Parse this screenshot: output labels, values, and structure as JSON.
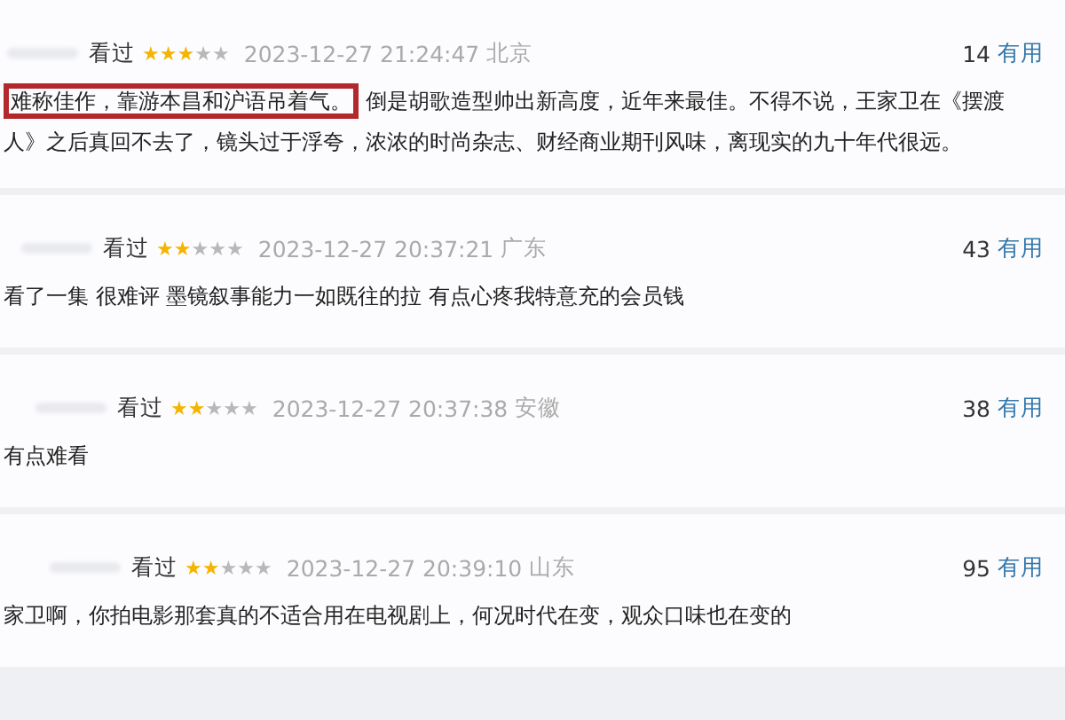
{
  "reviews": [
    {
      "status": "看过",
      "stars": 3,
      "time": "2023-12-27 21:24:47",
      "location": "北京",
      "votes": "14",
      "vote_label": "有用",
      "highlight": "难称佳作，靠游本昌和沪语吊着气。",
      "text": "倒是胡歌造型帅出新高度，近年来最佳。不得不说，王家卫在《摆渡人》之后真回不去了，镜头过于浮夸，浓浓的时尚杂志、财经商业期刊风味，离现实的九十年代很远。"
    },
    {
      "status": "看过",
      "stars": 2,
      "time": "2023-12-27 20:37:21",
      "location": "广东",
      "votes": "43",
      "vote_label": "有用",
      "text": "看了一集 很难评 墨镜叙事能力一如既往的拉 有点心疼我特意充的会员钱"
    },
    {
      "status": "看过",
      "stars": 2,
      "time": "2023-12-27 20:37:38",
      "location": "安徽",
      "votes": "38",
      "vote_label": "有用",
      "text": "有点难看"
    },
    {
      "status": "看过",
      "stars": 2,
      "time": "2023-12-27 20:39:10",
      "location": "山东",
      "votes": "95",
      "vote_label": "有用",
      "text": "家卫啊，你拍电影那套真的不适合用在电视剧上，何况时代在变，观众口味也在变的"
    }
  ]
}
